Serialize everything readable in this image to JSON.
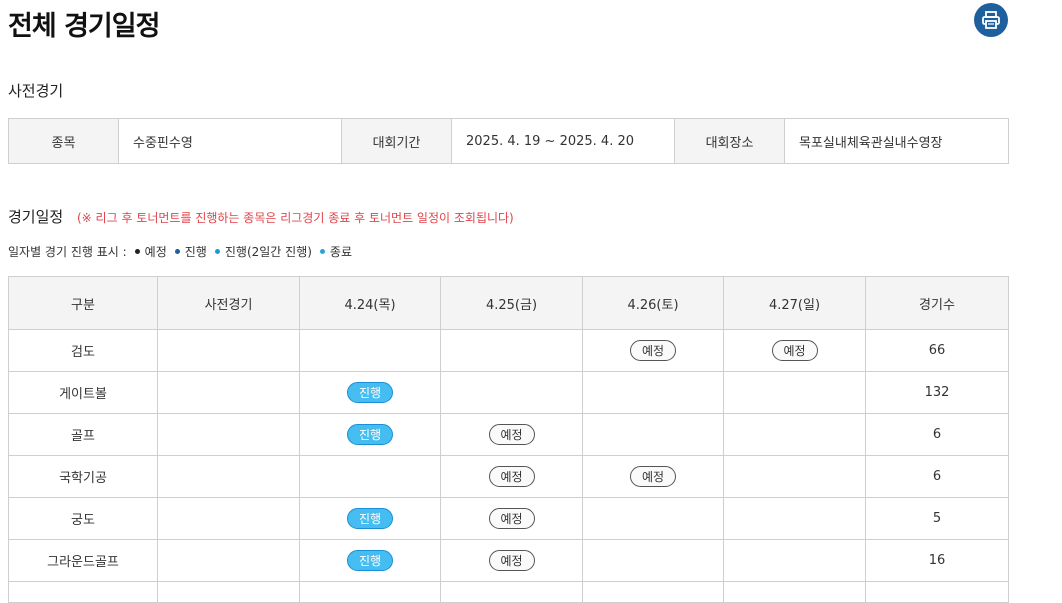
{
  "header": {
    "title": "전체 경기일정",
    "print_icon": "printer-icon",
    "print_color": "#1e5f9e"
  },
  "pre_game": {
    "section_title": "사전경기",
    "sport_label": "종목",
    "sport_value": "수중핀수영",
    "period_label": "대회기간",
    "period_value": "2025. 4. 19 ~ 2025. 4. 20",
    "venue_label": "대회장소",
    "venue_value": "목포실내체육관실내수영장"
  },
  "schedule": {
    "section_title": "경기일정",
    "note": "(※ 리그 후 토너먼트를 진행하는 종목은 리그경기 종료 후 토너먼트 일정이 조회됩니다)",
    "legend_label": "일자별 경기 진행 표시 :",
    "legend": [
      {
        "label": "예정",
        "color": "#222222"
      },
      {
        "label": "진행",
        "color": "#1e5f9e"
      },
      {
        "label": "진행(2일간 진행)",
        "color": "#1a9bd7"
      },
      {
        "label": "종료",
        "color": "#2aa3d8"
      }
    ],
    "columns": [
      "구분",
      "사전경기",
      "4.24(목)",
      "4.25(금)",
      "4.26(토)",
      "4.27(일)",
      "경기수"
    ],
    "rows": [
      {
        "name": "검도",
        "cells": [
          "",
          "",
          "",
          "예정",
          "예정"
        ],
        "count": "66"
      },
      {
        "name": "게이트볼",
        "cells": [
          "",
          "진행",
          "",
          "",
          ""
        ],
        "count": "132"
      },
      {
        "name": "골프",
        "cells": [
          "",
          "진행",
          "예정",
          "",
          ""
        ],
        "count": "6"
      },
      {
        "name": "국학기공",
        "cells": [
          "",
          "",
          "예정",
          "예정",
          ""
        ],
        "count": "6"
      },
      {
        "name": "궁도",
        "cells": [
          "",
          "진행",
          "예정",
          "",
          ""
        ],
        "count": "5"
      },
      {
        "name": "그라운드골프",
        "cells": [
          "",
          "진행",
          "예정",
          "",
          ""
        ],
        "count": "16"
      }
    ],
    "status_colors": {
      "scheduled_border": "#555555",
      "progress_fill": "#46bdf0"
    }
  }
}
